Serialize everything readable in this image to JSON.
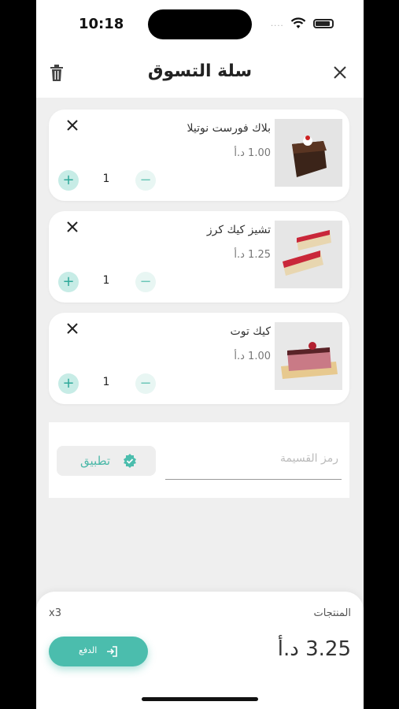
{
  "status": {
    "time": "10:18",
    "signal": "····"
  },
  "header": {
    "title": "سلة التسوق"
  },
  "cart": {
    "items": [
      {
        "name": "بلاك فورست نوتيلا",
        "price": "1.00 د.أ",
        "qty": "1",
        "plus": "+",
        "minus": "−"
      },
      {
        "name": "تشيز كيك كرز",
        "price": "1.25 د.أ",
        "qty": "1",
        "plus": "+",
        "minus": "−"
      },
      {
        "name": "كيك توت",
        "price": "1.00 د.أ",
        "qty": "1",
        "plus": "+",
        "minus": "−"
      }
    ]
  },
  "coupon": {
    "placeholder": "رمز القسيمة",
    "apply_label": "تطبيق"
  },
  "summary": {
    "count": "x3",
    "products_label": "المنتجات",
    "total": "3.25 د.أ",
    "pay_label": "الدفع"
  },
  "colors": {
    "accent": "#4bbdad",
    "accent_light": "#c7ece6",
    "background": "#efefef"
  },
  "icons": [
    "trash-icon",
    "close-icon",
    "remove-item-icon",
    "plus-icon",
    "minus-icon",
    "verified-check-icon",
    "login-icon"
  ]
}
